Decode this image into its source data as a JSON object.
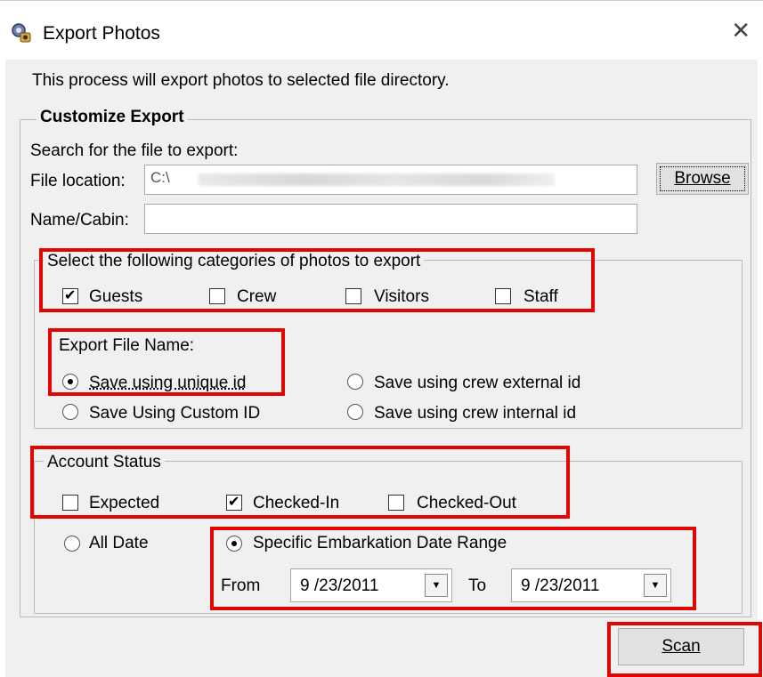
{
  "window": {
    "title": "Export Photos",
    "close_glyph": "✕"
  },
  "intro_text": "This process will export photos to selected file directory.",
  "customize": {
    "legend": "Customize Export",
    "search_label": "Search for the file to export:",
    "file_location_label": "File location:",
    "file_location_value": "C:\\",
    "browse_label": "Browse",
    "name_cabin_label": "Name/Cabin:",
    "name_cabin_value": ""
  },
  "categories": {
    "legend": "Select the following categories of photos to export",
    "items": [
      {
        "label": "Guests",
        "checked": true
      },
      {
        "label": "Crew",
        "checked": false
      },
      {
        "label": "Visitors",
        "checked": false
      },
      {
        "label": "Staff",
        "checked": false
      }
    ]
  },
  "export_file_name": {
    "label": "Export File Name:",
    "options": [
      {
        "label": "Save using unique id",
        "selected": true
      },
      {
        "label": "Save using crew external id",
        "selected": false
      },
      {
        "label": "Save Using Custom ID",
        "selected": false
      },
      {
        "label": "Save using crew internal id",
        "selected": false
      }
    ]
  },
  "account_status": {
    "legend": "Account Status",
    "items": [
      {
        "label": "Expected",
        "checked": false
      },
      {
        "label": "Checked-In",
        "checked": true
      },
      {
        "label": "Checked-Out",
        "checked": false
      }
    ]
  },
  "date": {
    "all_date_label": "All Date",
    "all_date_selected": false,
    "range_label": "Specific Embarkation Date Range",
    "range_selected": true,
    "from_label": "From",
    "from_value": "9 /23/2011",
    "to_label": "To",
    "to_value": "9 /23/2011"
  },
  "scan_label": "Scan",
  "highlight_color": "#e10600"
}
